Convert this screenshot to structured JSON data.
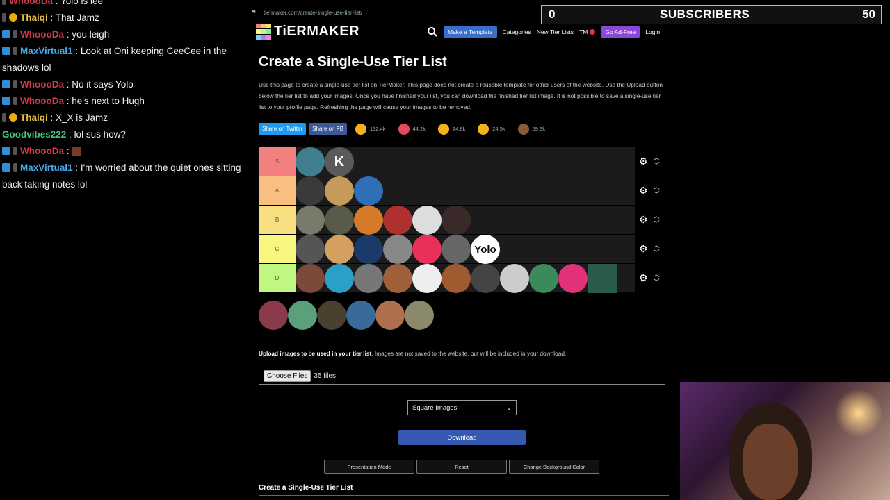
{
  "browser": {
    "url": "tiermaker.com/create-single-use-tier-list/"
  },
  "chat": [
    {
      "user": "WhoooDa",
      "msg": "Yolo is lee",
      "color": "#d33b4a",
      "icons": [
        "gray"
      ]
    },
    {
      "user": "Thaiqi",
      "msg": "That Jamz",
      "color": "#e6c34a",
      "icons": [
        "gray",
        "gold"
      ]
    },
    {
      "user": "WhoooDa",
      "msg": "you leigh",
      "color": "#d33b4a",
      "icons": [
        "blue",
        "gray"
      ]
    },
    {
      "user": "MaxVirtual1",
      "msg": "Look at Oni keeping CeeCee in the shadows lol",
      "color": "#4aa8e8",
      "icons": [
        "blue",
        "gray"
      ]
    },
    {
      "user": "WhoooDa",
      "msg": "No it says Yolo",
      "color": "#d33b4a",
      "icons": [
        "blue",
        "gray"
      ]
    },
    {
      "user": "WhoooDa",
      "msg": "he's next to Hugh",
      "color": "#d33b4a",
      "icons": [
        "blue",
        "gray"
      ]
    },
    {
      "user": "Thaiqi",
      "msg": "X_X is Jamz",
      "color": "#e6c34a",
      "icons": [
        "gray",
        "gold"
      ]
    },
    {
      "user": "Goodvibes222",
      "msg": "lol sus how?",
      "color": "#43c47a",
      "icons": []
    },
    {
      "user": "WhoooDa",
      "msg": "",
      "color": "#d33b4a",
      "icons": [
        "blue",
        "gray"
      ],
      "emote": true
    },
    {
      "user": "MaxVirtual1",
      "msg": "I'm worried about the quiet ones sitting back taking notes lol",
      "color": "#4aa8e8",
      "icons": [
        "blue",
        "gray"
      ]
    }
  ],
  "subs": {
    "current": "0",
    "label": "SUBSCRIBERS",
    "goal": "50"
  },
  "nav": {
    "logo": "TiERMAKER",
    "make_template": "Make a Template",
    "categories": "Categories",
    "new_lists": "New Tier Lists",
    "tm": "TM",
    "ad_free": "Go Ad-Free",
    "login": "Login"
  },
  "page": {
    "title": "Create a Single-Use Tier List",
    "desc": "Use this page to create a single-use tier list on TierMaker. This page does not create a reusable template for other users of the website. Use the Upload button below the tier list to add your images. Once you have finished your list, you can download the finished tier list image. It is not possible to save a single-use tier list to your profile page. Refreshing the page will cause your images to be removed.",
    "share_twitter": "Share on Twitter",
    "share_fb": "Share on FB",
    "reactions": [
      {
        "name": "grin-emoji",
        "count": "132.4k",
        "color": "#f5b21a"
      },
      {
        "name": "heart-eyes-emoji",
        "count": "44.2k",
        "color": "#e54a5a"
      },
      {
        "name": "laugh-emoji",
        "count": "24.8k",
        "color": "#f5b21a"
      },
      {
        "name": "raised-hands-emoji",
        "count": "24.5k",
        "color": "#f5b21a"
      },
      {
        "name": "poop-emoji",
        "count": "59.3k",
        "color": "#8b5a3c"
      }
    ],
    "upload_bold": "Upload images to be used in your tier list",
    "upload_rest": ". Images are not saved to the website, but will be included in your download.",
    "choose_files": "Choose Files",
    "file_count": "35 files",
    "image_shape": "Square Images",
    "download": "Download",
    "presentation": "Presentation Mode",
    "reset": "Reset",
    "change_bg": "Change Background Color",
    "footer_title": "Create a Single-Use Tier List"
  },
  "tiers": [
    {
      "label": "S",
      "color": "#f47f7f",
      "items": [
        {
          "c": "#3f7f8f"
        },
        {
          "c": "#5a5a5a",
          "t": "K"
        }
      ]
    },
    {
      "label": "A",
      "color": "#f8bf80",
      "items": [
        {
          "c": "#3a3a3a"
        },
        {
          "c": "#c79a5a"
        },
        {
          "c": "#2f6fb8"
        }
      ]
    },
    {
      "label": "B",
      "color": "#f8df80",
      "items": [
        {
          "c": "#7a7a6a"
        },
        {
          "c": "#5a5a4a"
        },
        {
          "c": "#d67a2a"
        },
        {
          "c": "#b03030"
        },
        {
          "c": "#ddd"
        },
        {
          "c": "#3a2a2a"
        }
      ]
    },
    {
      "label": "C",
      "color": "#f8f880",
      "items": [
        {
          "c": "#555"
        },
        {
          "c": "#d4a060"
        },
        {
          "c": "#1a3a6a"
        },
        {
          "c": "#888"
        },
        {
          "c": "#e8305a"
        },
        {
          "c": "#666"
        },
        {
          "c": "#fff",
          "t": "Yolo",
          "dark": true
        }
      ]
    },
    {
      "label": "D",
      "color": "#bff780",
      "items": [
        {
          "c": "#7a4a3a"
        },
        {
          "c": "#2aa0c8"
        },
        {
          "c": "#777"
        },
        {
          "c": "#a0603a"
        },
        {
          "c": "#eee"
        },
        {
          "c": "#a05a30"
        },
        {
          "c": "#444"
        },
        {
          "c": "#ccc"
        },
        {
          "c": "#3a8a5a"
        },
        {
          "c": "#e2307a"
        },
        {
          "c": "#2a5a4a",
          "sq": true
        }
      ]
    }
  ],
  "pool": [
    {
      "c": "#8a3a4a"
    },
    {
      "c": "#5aa07a"
    },
    {
      "c": "#4a4030"
    },
    {
      "c": "#3a6a9a"
    },
    {
      "c": "#b07050"
    },
    {
      "c": "#8a8a6a"
    }
  ],
  "colors": {
    "accent": "#3a6ec8",
    "ad_free": "#8b47d8",
    "download": "#3559b0"
  }
}
